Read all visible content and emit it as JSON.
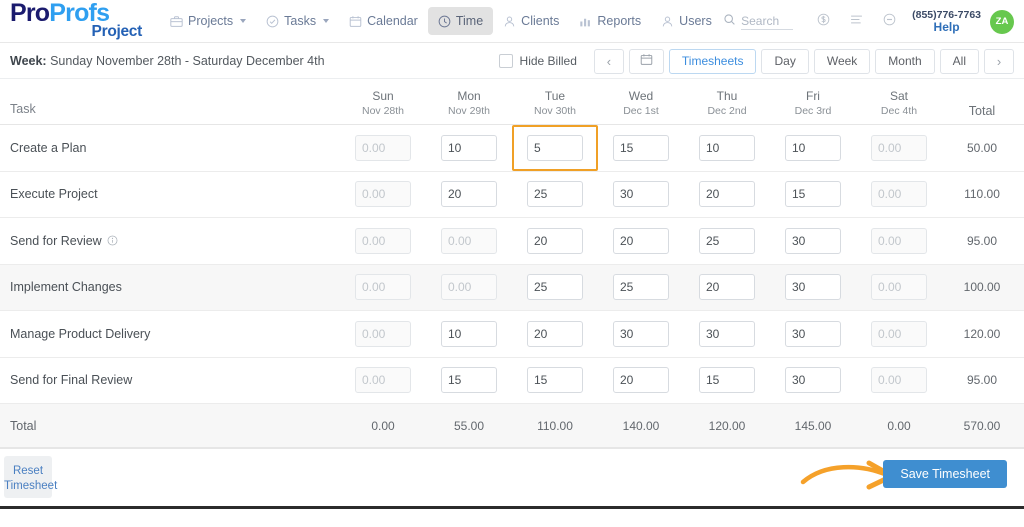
{
  "brand": {
    "logo_pro": "Pro",
    "logo_profs": "Profs",
    "logo_sub": "Project",
    "color_pro": "#1b1b6e",
    "color_profs": "#2f9ff0",
    "color_sub": "#2461b5"
  },
  "nav": {
    "items": [
      {
        "label": "Projects",
        "icon": "briefcase-icon",
        "caret": true,
        "active": false
      },
      {
        "label": "Tasks",
        "icon": "check-circle-icon",
        "caret": true,
        "active": false
      },
      {
        "label": "Calendar",
        "icon": "calendar-icon",
        "caret": false,
        "active": false
      },
      {
        "label": "Time",
        "icon": "clock-icon",
        "caret": false,
        "active": true
      },
      {
        "label": "Clients",
        "icon": "user-icon",
        "caret": false,
        "active": false
      },
      {
        "label": "Reports",
        "icon": "bar-chart-icon",
        "caret": false,
        "active": false
      },
      {
        "label": "Users",
        "icon": "person-icon",
        "caret": false,
        "active": false
      }
    ]
  },
  "topright": {
    "search_placeholder": "Search",
    "search_icon": "search-icon",
    "icons": [
      "dollar-circle-icon",
      "list-lines-icon",
      "minus-circle-icon"
    ],
    "phone": "(855)776-7763",
    "help": "Help",
    "avatar_initials": "ZA",
    "avatar_color": "#67c84e"
  },
  "weekbar": {
    "label_prefix": "Week:",
    "range": "Sunday November 28th - Saturday December 4th",
    "hide_billed_label": "Hide Billed",
    "hide_billed_checked": false,
    "prev_label": "‹",
    "next_label": "›",
    "calendar_icon": "calendar-icon",
    "views": [
      {
        "label": "Timesheets",
        "selected": true
      },
      {
        "label": "Day",
        "selected": false
      },
      {
        "label": "Week",
        "selected": false
      },
      {
        "label": "Month",
        "selected": false
      },
      {
        "label": "All",
        "selected": false
      }
    ]
  },
  "table": {
    "task_header": "Task",
    "total_header": "Total",
    "days": [
      {
        "dow": "Sun",
        "date": "Nov 28th"
      },
      {
        "dow": "Mon",
        "date": "Nov 29th"
      },
      {
        "dow": "Tue",
        "date": "Nov 30th"
      },
      {
        "dow": "Wed",
        "date": "Dec 1st"
      },
      {
        "dow": "Thu",
        "date": "Dec 2nd"
      },
      {
        "dow": "Fri",
        "date": "Dec 3rd"
      },
      {
        "dow": "Sat",
        "date": "Dec 4th"
      }
    ],
    "placeholder": "0.00",
    "focused_cell": {
      "row": 0,
      "col": 2
    },
    "focus_color": "#f0a026",
    "rows": [
      {
        "task": "Create a Plan",
        "info": false,
        "alt": false,
        "values": [
          "",
          "10",
          "5",
          "15",
          "10",
          "10",
          ""
        ],
        "disabled": [
          true,
          false,
          false,
          false,
          false,
          false,
          true
        ],
        "total": "50.00"
      },
      {
        "task": "Execute Project",
        "info": false,
        "alt": false,
        "values": [
          "",
          "20",
          "25",
          "30",
          "20",
          "15",
          ""
        ],
        "disabled": [
          true,
          false,
          false,
          false,
          false,
          false,
          true
        ],
        "total": "110.00"
      },
      {
        "task": "Send for Review",
        "info": true,
        "alt": false,
        "values": [
          "",
          "",
          "20",
          "20",
          "25",
          "30",
          ""
        ],
        "disabled": [
          true,
          true,
          false,
          false,
          false,
          false,
          true
        ],
        "total": "95.00"
      },
      {
        "task": "Implement Changes",
        "info": false,
        "alt": true,
        "values": [
          "",
          "",
          "25",
          "25",
          "20",
          "30",
          ""
        ],
        "disabled": [
          true,
          true,
          false,
          false,
          false,
          false,
          true
        ],
        "total": "100.00"
      },
      {
        "task": "Manage Product Delivery",
        "info": false,
        "alt": false,
        "values": [
          "",
          "10",
          "20",
          "30",
          "30",
          "30",
          ""
        ],
        "disabled": [
          true,
          false,
          false,
          false,
          false,
          false,
          true
        ],
        "total": "120.00"
      },
      {
        "task": "Send for Final Review",
        "info": false,
        "alt": false,
        "values": [
          "",
          "15",
          "15",
          "20",
          "15",
          "30",
          ""
        ],
        "disabled": [
          true,
          false,
          false,
          false,
          false,
          false,
          true
        ],
        "total": "95.00"
      }
    ],
    "totals": {
      "label": "Total",
      "days": [
        "0.00",
        "55.00",
        "110.00",
        "140.00",
        "120.00",
        "145.00",
        "0.00"
      ],
      "grand": "570.00"
    }
  },
  "footer": {
    "reset_label_line1": "Reset",
    "reset_label_line2": "Timesheet",
    "save_label": "Save Timesheet",
    "save_color": "#3f8ed0",
    "annotation_arrow_color": "#f5a12a"
  }
}
